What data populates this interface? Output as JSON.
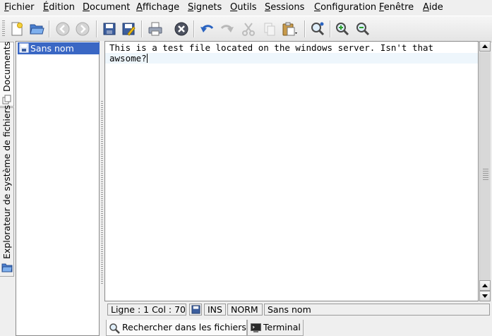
{
  "menubar": {
    "items": [
      "Fichier",
      "Édition",
      "Document",
      "Affichage",
      "Signets",
      "Outils",
      "Sessions",
      "Configuration",
      "Fenêtre",
      "Aide"
    ]
  },
  "toolbar": {
    "buttons": [
      "new-document",
      "open-folder",
      "back",
      "forward",
      "save",
      "save-as",
      "print",
      "close-document",
      "undo",
      "redo",
      "cut",
      "copy",
      "paste",
      "find",
      "zoom-in",
      "zoom-out"
    ]
  },
  "sidebar": {
    "tabs": [
      "Documents",
      "Explorateur de système de fichiers"
    ]
  },
  "document_list": {
    "items": [
      {
        "label": "Sans nom",
        "selected": true
      }
    ]
  },
  "editor": {
    "lines": [
      "This is a test file located on the windows server. Isn't that",
      "awsome?"
    ]
  },
  "statusbar": {
    "position": "Ligne : 1 Col : 70",
    "mode_insert": "INS",
    "mode_norm": "NORM",
    "document_name": "Sans nom"
  },
  "bottom_tabs": [
    "Rechercher dans les fichiers",
    "Terminal"
  ],
  "colors": {
    "selection": "#3a67c4",
    "current_line": "#eef6fc",
    "background": "#efefef"
  }
}
